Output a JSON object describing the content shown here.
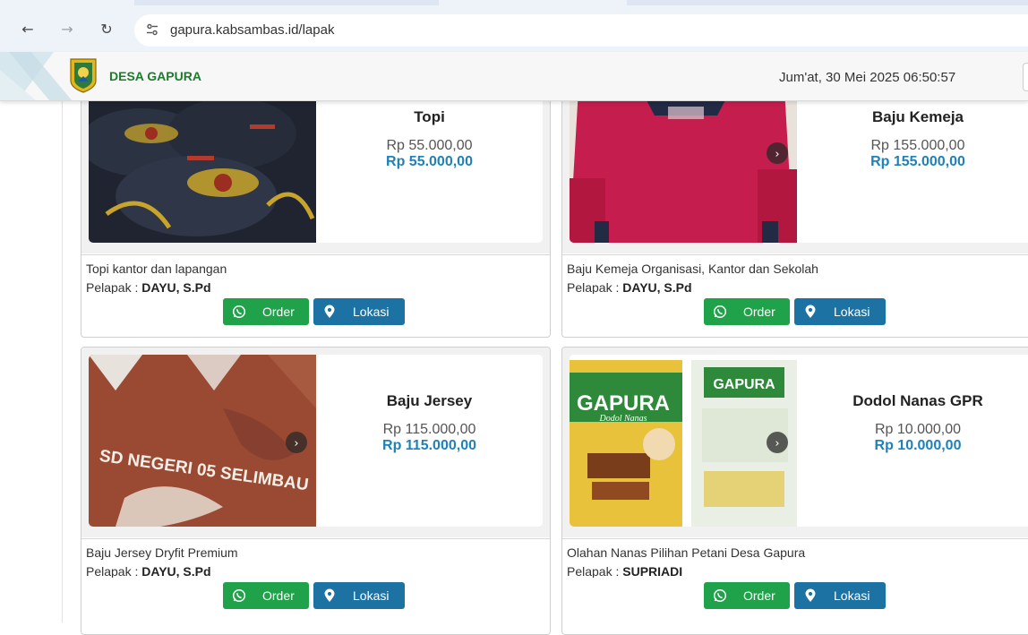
{
  "browser": {
    "back_icon": "arrow-left-icon",
    "forward_icon": "arrow-right-icon",
    "reload_icon": "reload-icon",
    "site_info_icon": "tune-icon",
    "url": "gapura.kabsambas.id/lapak"
  },
  "header": {
    "brand": "DESA GAPURA",
    "datetime": "Jum'at, 30 Mei 2025  06:50:57",
    "brand_color": "#1a7d2a"
  },
  "colors": {
    "order_button": "#20a24a",
    "location_button": "#1b72a3",
    "discount_price": "#1e81b8"
  },
  "products": [
    {
      "name": "Topi",
      "price": "Rp 55.000,00",
      "final_price": "Rp 55.000,00",
      "description": "Topi kantor dan lapangan",
      "seller_label": "Pelapak : ",
      "seller": "DAYU, S.Pd",
      "order_label": "Order",
      "location_label": "Lokasi"
    },
    {
      "name": "Baju Kemeja",
      "price": "Rp 155.000,00",
      "final_price": "Rp 155.000,00",
      "description": "Baju Kemeja Organisasi, Kantor dan Sekolah",
      "seller_label": "Pelapak : ",
      "seller": "DAYU, S.Pd",
      "order_label": "Order",
      "location_label": "Lokasi"
    },
    {
      "name": "Baju Jersey",
      "price": "Rp 115.000,00",
      "final_price": "Rp 115.000,00",
      "description": "Baju Jersey Dryfit Premium",
      "seller_label": "Pelapak : ",
      "seller": "DAYU, S.Pd",
      "order_label": "Order",
      "location_label": "Lokasi",
      "image_text": "SD NEGERI 05 SELIMBAU"
    },
    {
      "name": "Dodol Nanas GPR",
      "price": "Rp 10.000,00",
      "final_price": "Rp 10.000,00",
      "description": "Olahan Nanas Pilihan Petani Desa Gapura",
      "seller_label": "Pelapak : ",
      "seller": "SUPRIADI",
      "order_label": "Order",
      "location_label": "Lokasi",
      "image_text": "GAPURA",
      "image_subtext": "Dodol Nanas"
    }
  ]
}
